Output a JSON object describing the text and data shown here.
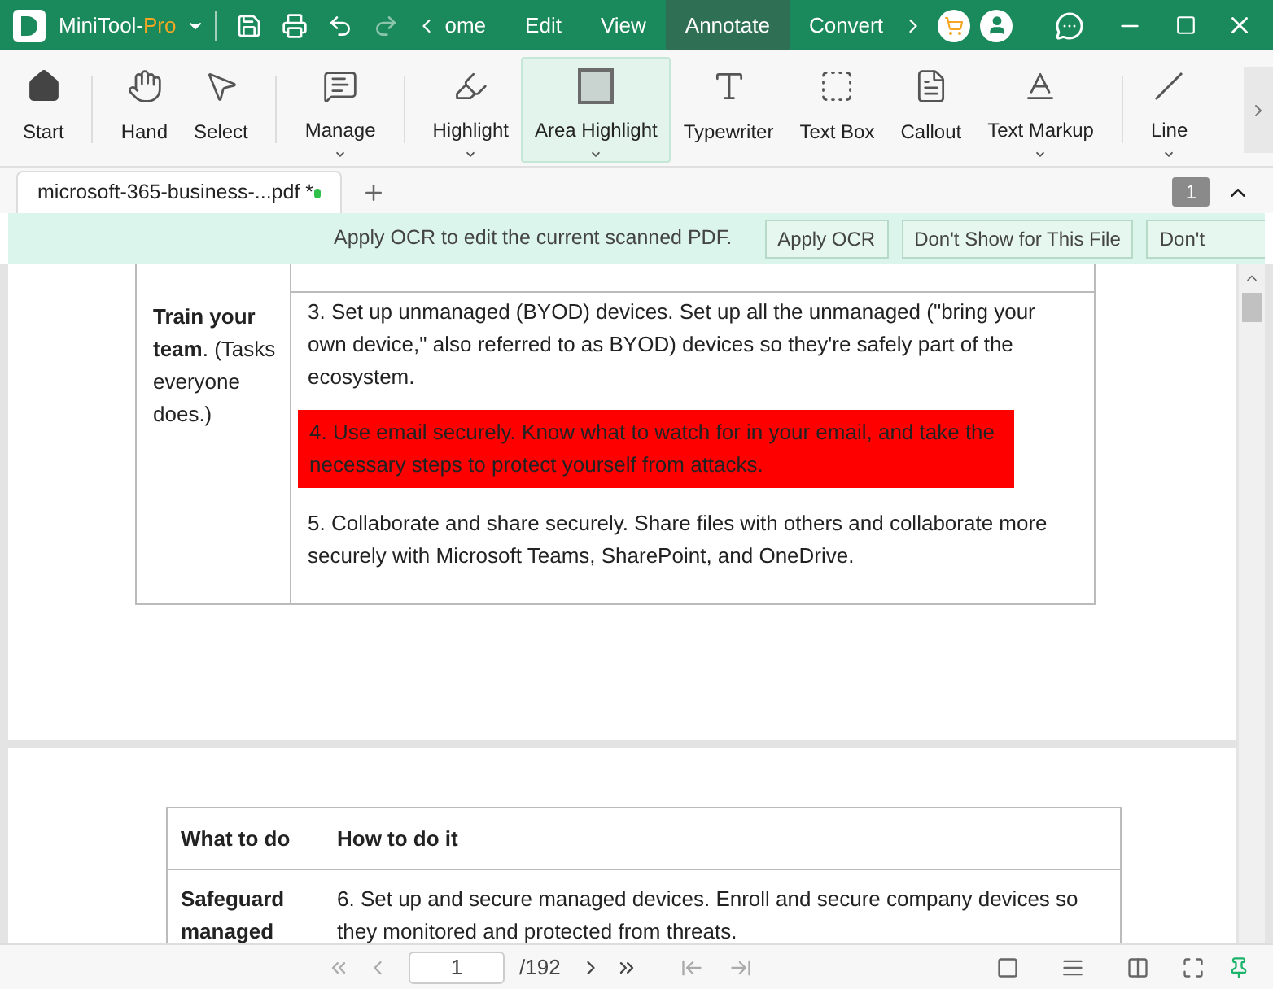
{
  "titlebar": {
    "brand": "MiniTool-",
    "edition": "Pro",
    "menu": [
      {
        "label": "ome",
        "selected": false
      },
      {
        "label": "Edit",
        "selected": false
      },
      {
        "label": "View",
        "selected": false
      },
      {
        "label": "Annotate",
        "selected": true
      },
      {
        "label": "Convert",
        "selected": false
      }
    ]
  },
  "toolbar": {
    "groups": [
      [
        {
          "label": "Start",
          "dropdown": false,
          "selected": false
        }
      ],
      [
        {
          "label": "Hand",
          "dropdown": false,
          "selected": false
        },
        {
          "label": "Select",
          "dropdown": false,
          "selected": false
        }
      ],
      [
        {
          "label": "Manage",
          "dropdown": true,
          "selected": false
        }
      ],
      [
        {
          "label": "Highlight",
          "dropdown": true,
          "selected": false
        },
        {
          "label": "Area Highlight",
          "dropdown": true,
          "selected": true
        },
        {
          "label": "Typewriter",
          "dropdown": false,
          "selected": false
        },
        {
          "label": "Text Box",
          "dropdown": false,
          "selected": false
        },
        {
          "label": "Callout",
          "dropdown": false,
          "selected": false
        },
        {
          "label": "Text Markup",
          "dropdown": true,
          "selected": false
        }
      ],
      [
        {
          "label": "Line",
          "dropdown": true,
          "selected": false
        }
      ]
    ]
  },
  "document_tab": {
    "label": "microsoft-365-business-...pdf *",
    "modified": true,
    "page_badge": "1"
  },
  "ocr_banner": {
    "message": "Apply OCR to edit the current scanned PDF.",
    "buttons": [
      "Apply OCR",
      "Don't Show for This File",
      "Don't"
    ]
  },
  "page_1": {
    "row_label": "**Train your team**. (Tasks everyone does.)",
    "items": [
      {
        "text": "3. Set up unmanaged (BYOD) devices. Set up all the unmanaged (\"bring your own device,\" also referred to as BYOD) devices so they're safely part of the ecosystem.",
        "highlighted": false
      },
      {
        "text": "4. Use email securely. Know what to watch for in your email, and take the necessary steps to protect yourself from attacks.",
        "highlighted": true
      },
      {
        "text": "5. Collaborate and share securely. Share files with others and collaborate more securely with Microsoft Teams, SharePoint, and OneDrive.",
        "highlighted": false
      }
    ]
  },
  "page_2": {
    "columns": [
      "What to do",
      "How to do it"
    ],
    "row_label": "Safeguard managed",
    "row_text": "6. Set up and secure managed devices. Enroll and secure company devices so they monitored and protected from threats."
  },
  "status_bar": {
    "page_input": "1",
    "total_pages": "/192"
  }
}
